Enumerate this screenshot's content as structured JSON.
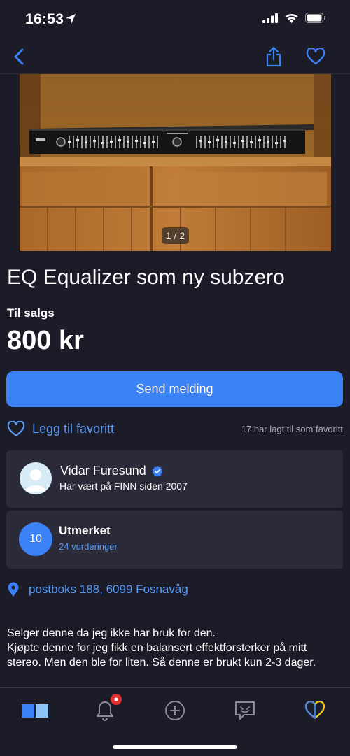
{
  "status_bar": {
    "time": "16:53"
  },
  "listing": {
    "photo_counter": "1 / 2",
    "title": "EQ Equalizer som ny subzero",
    "sale_label": "Til salgs",
    "price": "800 kr"
  },
  "actions": {
    "send_message": "Send melding",
    "add_favorite": "Legg til favoritt",
    "favorite_count": "17 har lagt til som favoritt"
  },
  "seller": {
    "name": "Vidar Furesund",
    "since": "Har vært på FINN siden 2007"
  },
  "rating": {
    "score": "10",
    "label": "Utmerket",
    "reviews": "24 vurderinger"
  },
  "location": "postboks 188, 6099 Fosnavåg",
  "description": "Selger denne da jeg ikke har bruk for den.\nKjøpte denne for jeg fikk en balansert effektforsterker på mitt stereo. Men den ble for liten. Så denne er brukt kun 2-3 dager.",
  "colors": {
    "accent": "#3b82f6",
    "link": "#5a9bf6",
    "background": "#1c1c28",
    "card": "#2a2a38",
    "tab_favorite": "#f5c518"
  },
  "icons": [
    "location-arrow-icon",
    "signal-icon",
    "wifi-icon",
    "battery-icon",
    "back-chevron-icon",
    "share-icon",
    "heart-icon",
    "verified-badge-icon",
    "location-pin-icon",
    "home-tab-icon",
    "bell-icon",
    "plus-circle-icon",
    "message-icon",
    "heart-tab-icon"
  ]
}
